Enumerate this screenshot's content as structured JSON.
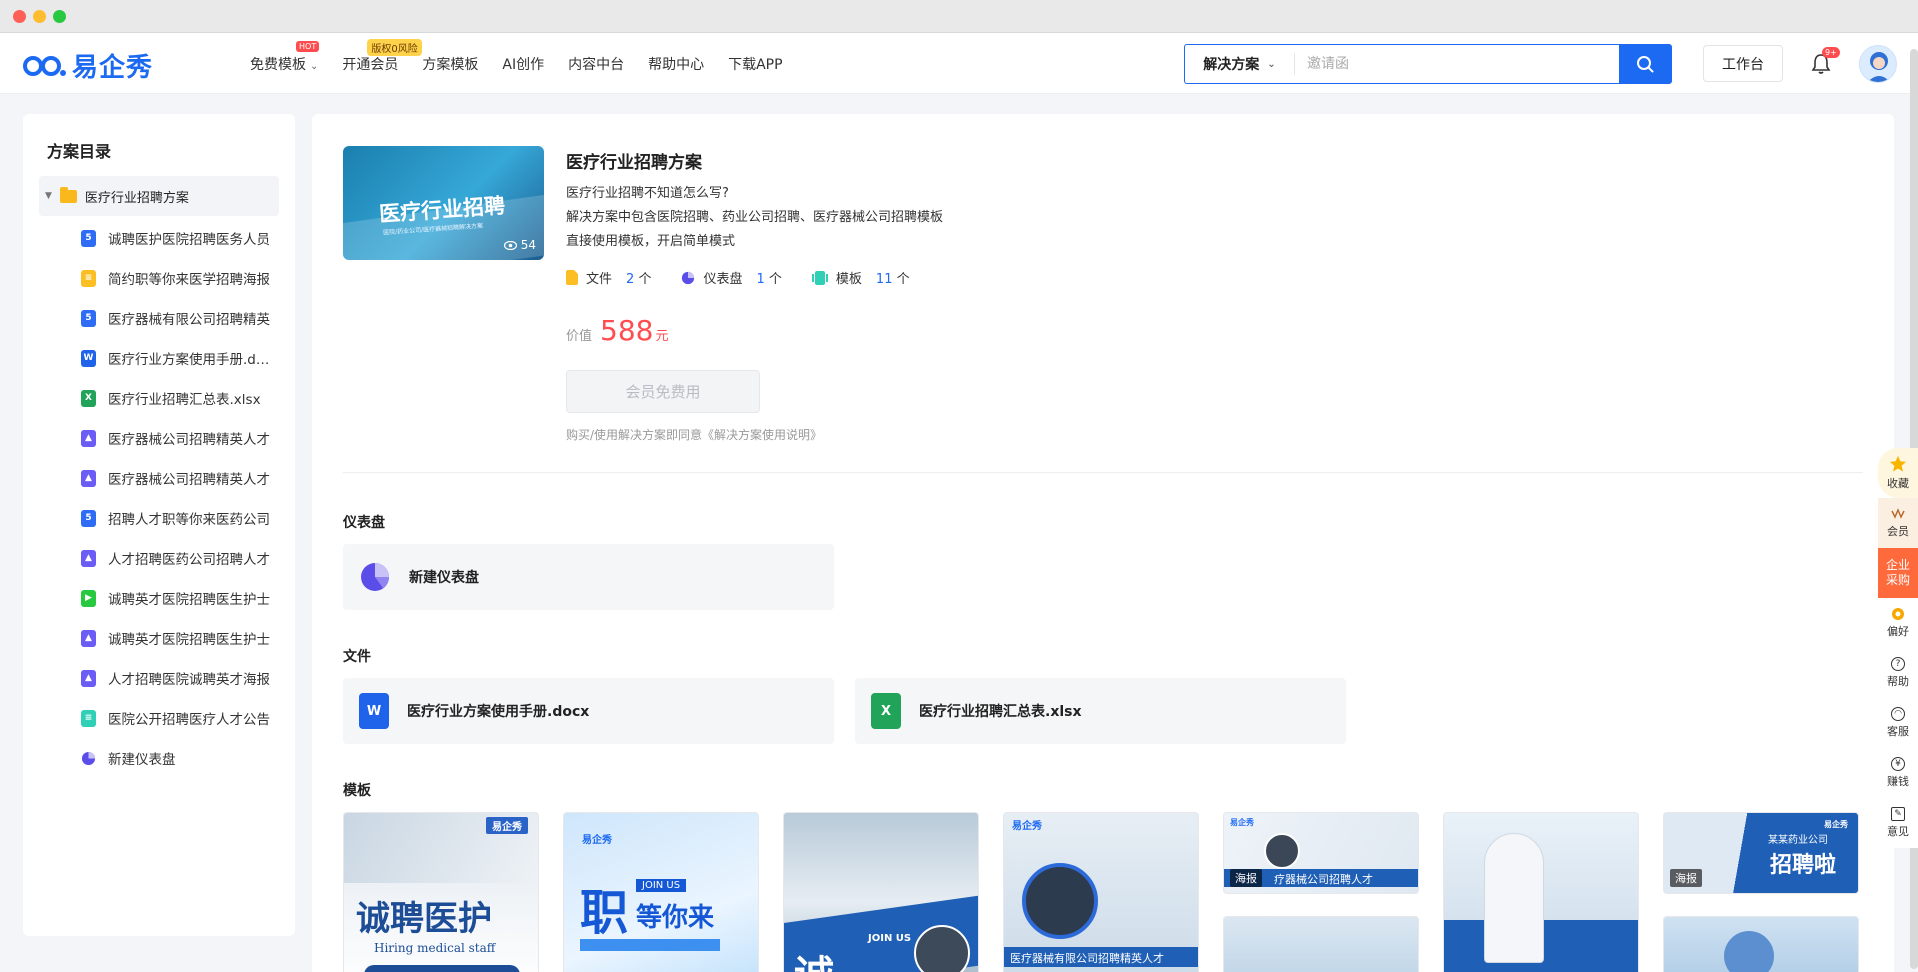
{
  "window": {
    "buttons": [
      "close",
      "minimize",
      "zoom"
    ]
  },
  "header": {
    "logo_text": "易企秀",
    "nav": [
      {
        "label": "免费模板",
        "badge": "HOT",
        "has_dropdown": true
      },
      {
        "label": "开通会员",
        "badge": "版权0风险"
      },
      {
        "label": "方案模板"
      },
      {
        "label": "AI创作"
      },
      {
        "label": "内容中台"
      },
      {
        "label": "帮助中心"
      },
      {
        "label": "下载APP"
      }
    ],
    "search": {
      "type_label": "解决方案",
      "placeholder": "邀请函",
      "value": ""
    },
    "workbench_label": "工作台",
    "notification_badge": "9+"
  },
  "sidebar": {
    "title": "方案目录",
    "root_label": "医疗行业招聘方案",
    "items": [
      {
        "label": "诚聘医护医院招聘医务人员",
        "icon": "h5-icon"
      },
      {
        "label": "简约职等你来医学招聘海报",
        "icon": "doc-icon"
      },
      {
        "label": "医疗器械有限公司招聘精英",
        "icon": "h5-icon"
      },
      {
        "label": "医疗行业方案使用手册.docx",
        "icon": "word-icon"
      },
      {
        "label": "医疗行业招聘汇总表.xlsx",
        "icon": "excel-icon"
      },
      {
        "label": "医疗器械公司招聘精英人才",
        "icon": "image-icon"
      },
      {
        "label": "医疗器械公司招聘精英人才",
        "icon": "image-icon"
      },
      {
        "label": "招聘人才职等你来医药公司",
        "icon": "h5-icon"
      },
      {
        "label": "人才招聘医药公司招聘人才",
        "icon": "image-icon"
      },
      {
        "label": "诚聘英才医院招聘医生护士",
        "icon": "video-icon"
      },
      {
        "label": "诚聘英才医院招聘医生护士",
        "icon": "image-icon"
      },
      {
        "label": "人才招聘医院诚聘英才海报",
        "icon": "image-icon"
      },
      {
        "label": "医院公开招聘医疗人才公告",
        "icon": "text-icon"
      },
      {
        "label": "新建仪表盘",
        "icon": "dashboard-icon"
      }
    ]
  },
  "solution": {
    "title": "医疗行业招聘方案",
    "cover_title": "医疗行业招聘",
    "cover_subtitle": "医院/药业公司/医疗器械招聘解决方案",
    "views": "54",
    "desc": [
      "医疗行业招聘不知道怎么写?",
      "解决方案中包含医院招聘、药业公司招聘、医疗器械公司招聘模板",
      "直接使用模板，开启简单模式"
    ],
    "stats": [
      {
        "label": "文件",
        "count": "2",
        "unit": "个",
        "icon": "file-icon"
      },
      {
        "label": "仪表盘",
        "count": "1",
        "unit": "个",
        "icon": "dashboard-icon"
      },
      {
        "label": "模板",
        "count": "11",
        "unit": "个",
        "icon": "template-icon"
      }
    ],
    "value_label": "价值",
    "value": "588",
    "value_unit": "元",
    "free_button": "会员免费用",
    "agreement": "购买/使用解决方案即同意《解决方案使用说明》"
  },
  "sections": {
    "dashboard_title": "仪表盘",
    "dashboard_card": "新建仪表盘",
    "files_title": "文件",
    "files": [
      {
        "name": "医疗行业方案使用手册.docx",
        "type": "W"
      },
      {
        "name": "医疗行业招聘汇总表.xlsx",
        "type": "X"
      }
    ],
    "templates_title": "模板",
    "templates": [
      {
        "big_text": "诚聘医护",
        "sub_text": "Hiring medical staff",
        "logo": "易企秀"
      },
      {
        "big_text": "职",
        "side_text": "等你来",
        "badge": "JOIN US",
        "logo": "易企秀"
      },
      {
        "big_text": "诚",
        "badge": "JOIN US"
      },
      {
        "caption": "医疗器械有限公司招聘精英人才",
        "logo": "易企秀"
      },
      {
        "caption": "疗器械公司招聘人才",
        "tag": "海报",
        "logo": "易企秀"
      },
      {
        "caption": ""
      },
      {
        "big_text": "招聘啦",
        "header": "某某药业公司",
        "tag": "海报",
        "logo": "易企秀"
      }
    ]
  },
  "floatbar": [
    {
      "label": "收藏",
      "icon": "star-icon"
    },
    {
      "label": "会员",
      "icon": "vip-icon"
    },
    {
      "label": "企业采购",
      "icon": ""
    },
    {
      "label": "偏好",
      "icon": "preference-icon"
    },
    {
      "label": "帮助",
      "icon": "help-icon"
    },
    {
      "label": "客服",
      "icon": "headset-icon"
    },
    {
      "label": "赚钱",
      "icon": "money-icon"
    },
    {
      "label": "意见",
      "icon": "feedback-icon"
    }
  ],
  "colors": {
    "brand": "#1d6af2",
    "price": "#ff4d4f",
    "purchase": "#ff6a3d"
  }
}
